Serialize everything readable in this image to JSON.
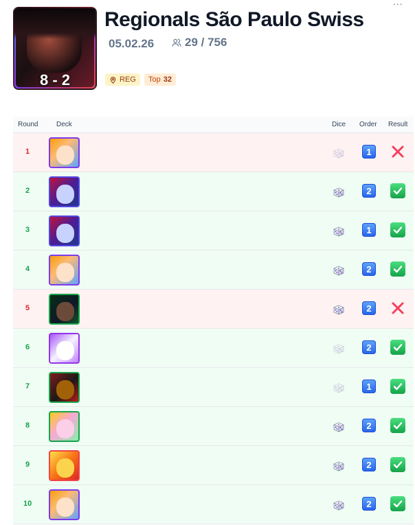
{
  "header": {
    "title": "Regionals São Paulo Swiss",
    "date": "05.02.26",
    "players": "29 / 756",
    "score": "8 - 2",
    "more_label": "...",
    "tags": {
      "reg": "REG",
      "top_prefix": "Top",
      "top_value": "32"
    }
  },
  "table": {
    "columns": {
      "round": "Round",
      "deck": "Deck",
      "dice": "Dice",
      "order": "Order",
      "result": "Result"
    },
    "rows": [
      {
        "round": "1",
        "result": "loss",
        "dice": "lost",
        "order": "1",
        "deck_icon": "nami-portrait-icon"
      },
      {
        "round": "2",
        "result": "win",
        "dice": "won",
        "order": "2",
        "deck_icon": "purple-blue-leader-icon"
      },
      {
        "round": "3",
        "result": "win",
        "dice": "won",
        "order": "1",
        "deck_icon": "purple-blue-leader-icon"
      },
      {
        "round": "4",
        "result": "win",
        "dice": "won",
        "order": "2",
        "deck_icon": "nami-portrait-icon"
      },
      {
        "round": "5",
        "result": "loss",
        "dice": "won",
        "order": "2",
        "deck_icon": "green-swordsman-icon"
      },
      {
        "round": "6",
        "result": "win",
        "dice": "lost",
        "order": "2",
        "deck_icon": "white-purple-leader-icon"
      },
      {
        "round": "7",
        "result": "win",
        "dice": "lost",
        "order": "1",
        "deck_icon": "red-pirate-icon"
      },
      {
        "round": "8",
        "result": "win",
        "dice": "won",
        "order": "2",
        "deck_icon": "pink-hair-leader-icon"
      },
      {
        "round": "9",
        "result": "win",
        "dice": "won",
        "order": "2",
        "deck_icon": "yellow-fighter-icon"
      },
      {
        "round": "10",
        "result": "win",
        "dice": "won",
        "order": "2",
        "deck_icon": "nami-portrait-icon"
      }
    ]
  },
  "colors": {
    "win_bg": "#f0fdf4",
    "loss_bg": "#fef2f2",
    "win_text": "#16a34a",
    "loss_text": "#dc2626",
    "order_blue": "#2563eb"
  }
}
